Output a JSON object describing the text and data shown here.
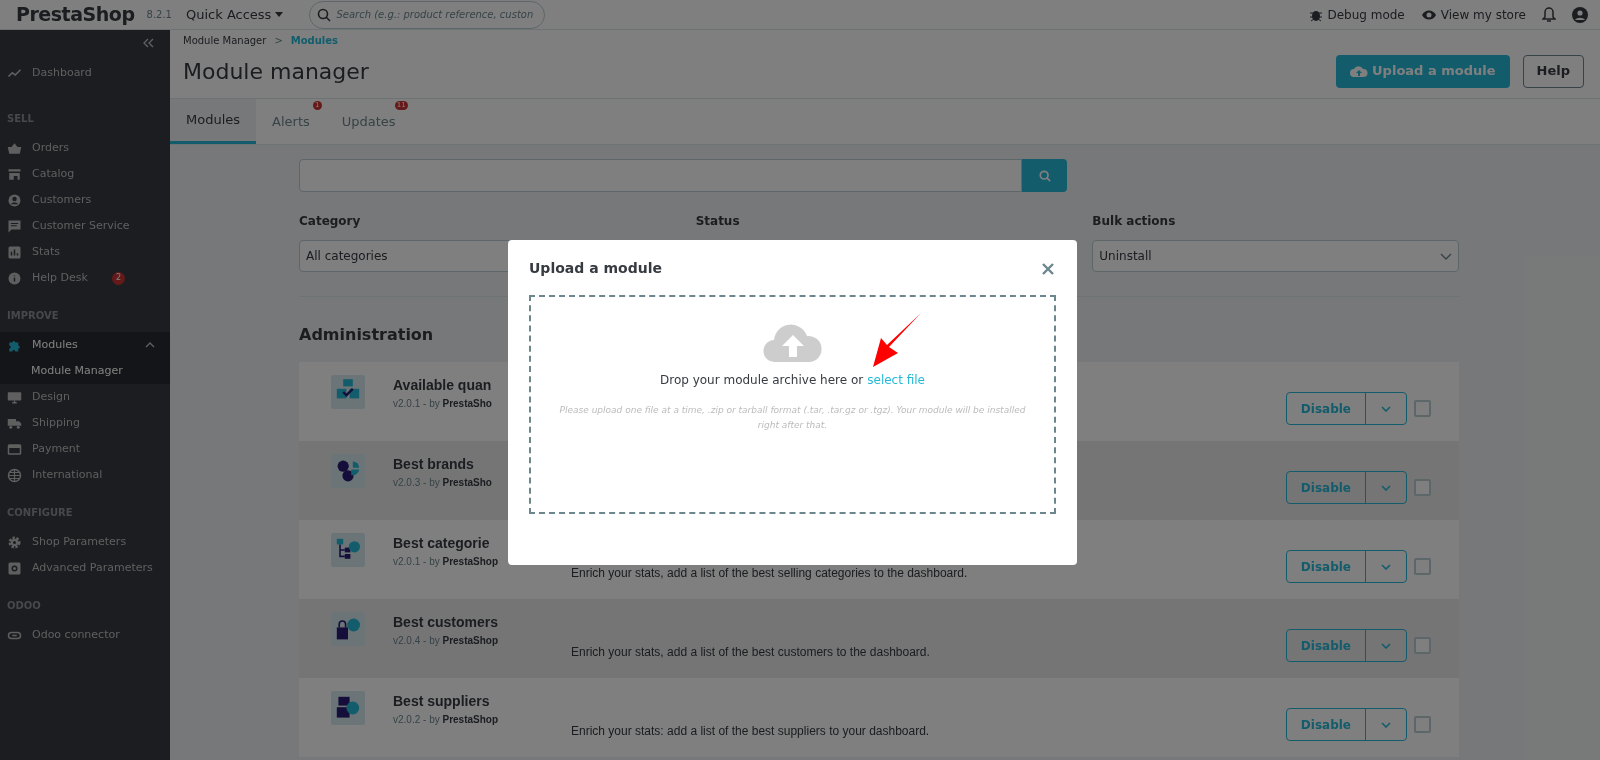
{
  "header": {
    "brand": "PrestaShop",
    "version": "8.2.1",
    "quick_access": "Quick Access",
    "search": {
      "placeholder": "Search (e.g.: product reference, custon"
    },
    "links": [
      "Debug mode",
      "View my store"
    ]
  },
  "sidebar": {
    "sections": [
      {
        "items": [
          {
            "label": "Dashboard",
            "selected": false
          }
        ]
      },
      {
        "title": "SELL",
        "items": [
          {
            "label": "Orders",
            "selected": false
          },
          {
            "label": "Catalog",
            "selected": false
          },
          {
            "label": "Customers",
            "selected": false
          },
          {
            "label": "Customer Service",
            "selected": false
          },
          {
            "label": "Stats",
            "selected": false
          },
          {
            "label": "Help Desk",
            "selected": false,
            "badge": "2"
          }
        ]
      },
      {
        "title": "IMPROVE",
        "items": [
          {
            "label": "Modules",
            "selected": true,
            "expanded": true,
            "children": [
              {
                "label": "Module Manager"
              }
            ]
          },
          {
            "label": "Design",
            "selected": false
          },
          {
            "label": "Shipping",
            "selected": false
          },
          {
            "label": "Payment",
            "selected": false
          },
          {
            "label": "International",
            "selected": false
          }
        ]
      },
      {
        "title": "CONFIGURE",
        "items": [
          {
            "label": "Shop Parameters",
            "selected": false
          },
          {
            "label": "Advanced Parameters",
            "selected": false
          }
        ]
      },
      {
        "title": "ODOO",
        "items": [
          {
            "label": "Odoo connector",
            "selected": false
          }
        ]
      }
    ]
  },
  "breadcrumb": {
    "items": [
      "Module Manager",
      "Modules"
    ],
    "separator": ">"
  },
  "page_title": "Module manager",
  "toolbar_buttons": [
    {
      "label": "Upload a module",
      "kind": "primary"
    },
    {
      "label": "Help",
      "kind": "outline"
    }
  ],
  "tabs": [
    {
      "label": "Modules",
      "selected": true
    },
    {
      "label": "Alerts",
      "selected": false,
      "badge": "1"
    },
    {
      "label": "Updates",
      "selected": false,
      "badge": "11"
    }
  ],
  "filters": [
    {
      "label": "Category",
      "value": "All categories"
    },
    {
      "label": "Status"
    },
    {
      "label": "Bulk actions",
      "value": "Uninstall"
    }
  ],
  "section_title": "Administration",
  "modules": [
    {
      "name": "Available quan",
      "meta": "v2.0.1 - by **PrestaSho**",
      "action": "Disable",
      "checked": false
    },
    {
      "name": "Best brands",
      "meta": "v2.0.3 - by **PrestaSho**",
      "action": "Disable",
      "checked": false
    },
    {
      "name": "Best categorie",
      "meta": "v2.0.1 - by **PrestaShop**",
      "description": "Enrich your stats, add a list of the best selling categories to the dashboard.",
      "action": "Disable",
      "checked": false
    },
    {
      "name": "Best customers",
      "meta": "v2.0.4 - by **PrestaShop**",
      "description": "Enrich your stats, add a list of the best customers to the dashboard.",
      "action": "Disable",
      "checked": false
    },
    {
      "name": "Best suppliers",
      "meta": "v2.0.2 - by **PrestaShop**",
      "description": "Enrich your stats: add a list of the best suppliers to your dashboard.",
      "action": "Disable",
      "checked": false
    }
  ],
  "modal": {
    "title": "Upload a module",
    "drop_text": "Drop your module archive here or",
    "link": "select file",
    "hint": "Please upload one file at a time, .zip or tarball format (.tar, .tar.gz or .tgz). Your module will be installed right after that."
  }
}
